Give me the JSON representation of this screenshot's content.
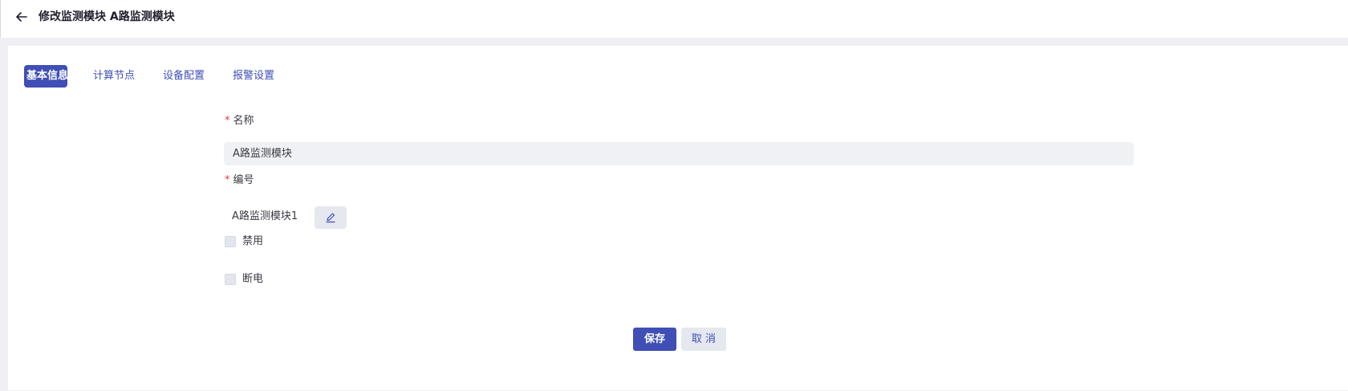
{
  "header": {
    "title": "修改监测模块 A路监测模块",
    "back_icon": "arrow-left-icon"
  },
  "tabs": [
    {
      "label": "基本信息",
      "active": true
    },
    {
      "label": "计算节点",
      "active": false
    },
    {
      "label": "设备配置",
      "active": false
    },
    {
      "label": "报警设置",
      "active": false
    }
  ],
  "form": {
    "name": {
      "required_mark": "*",
      "label": "名称",
      "value": "A路监测模块"
    },
    "code": {
      "required_mark": "*",
      "label": "编号",
      "value": "A路监测模块1",
      "edit_icon": "pencil-icon"
    },
    "disabled": {
      "label": "禁用",
      "checked": false
    },
    "power_off": {
      "label": "断电",
      "checked": false
    }
  },
  "actions": {
    "save_label": "保存",
    "cancel_label": "取 消"
  },
  "colors": {
    "accent": "#3f4fb5",
    "required": "#e03a3a",
    "background": "#f0f0f4"
  }
}
